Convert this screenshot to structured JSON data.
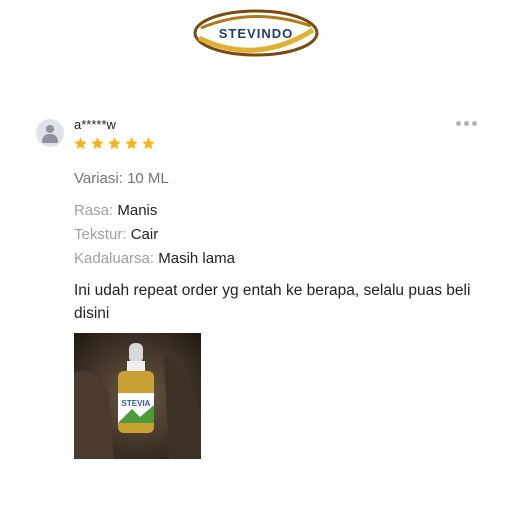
{
  "logo": {
    "text": "STEVINDO"
  },
  "review": {
    "username": "a*****w",
    "rating": 5,
    "variant": "Variasi: 10 ML",
    "attributes": [
      {
        "key": "Rasa:",
        "value": "Manis"
      },
      {
        "key": "Tekstur:",
        "value": "Cair"
      },
      {
        "key": "Kadaluarsa:",
        "value": "Masih lama"
      }
    ],
    "comment": "Ini udah repeat order yg entah ke berapa, selalu puas beli disini",
    "photo": {
      "label": "STEVIA"
    }
  },
  "colors": {
    "star": "#f6b21a",
    "logo_gold": "#c9961c",
    "logo_brown": "#7a4a12",
    "logo_text": "#1d3f73"
  },
  "icons": {
    "avatar": "person-icon",
    "more": "more-options-icon",
    "star": "star-icon"
  }
}
